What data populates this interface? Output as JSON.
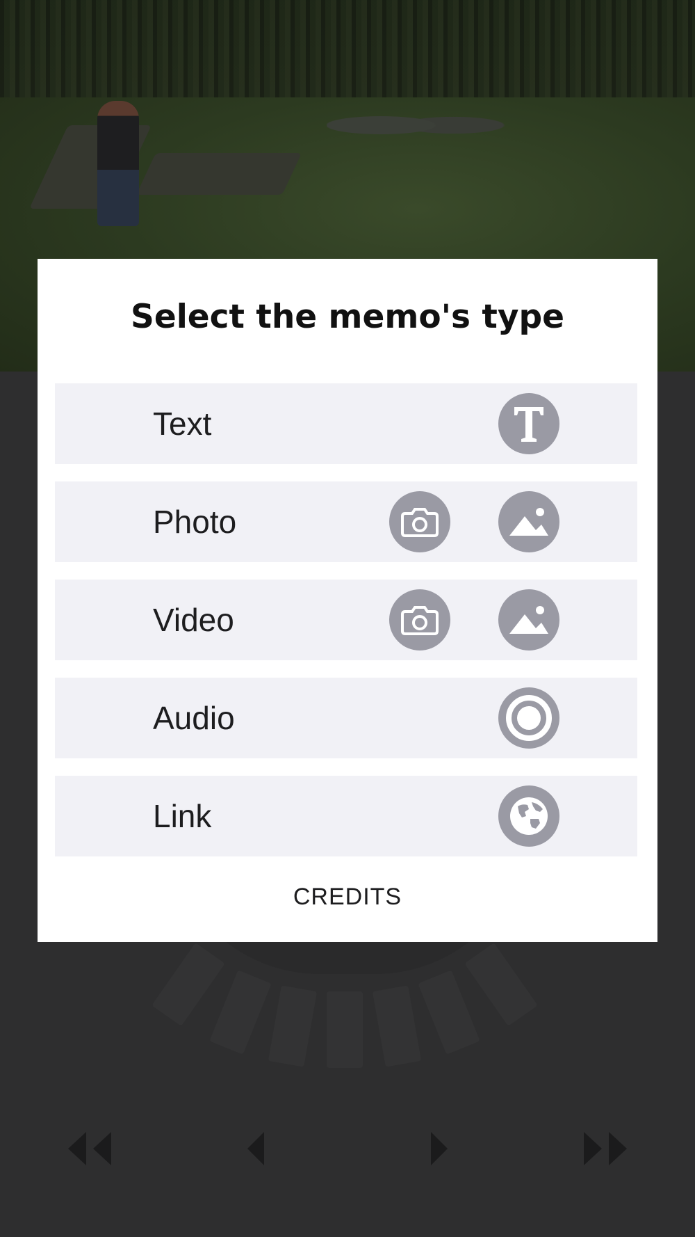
{
  "dialog": {
    "title": "Select the memo's type",
    "options": [
      {
        "label": "Text",
        "icons": [
          "text-icon"
        ]
      },
      {
        "label": "Photo",
        "icons": [
          "camera-icon",
          "gallery-icon"
        ]
      },
      {
        "label": "Video",
        "icons": [
          "camera-icon",
          "gallery-icon"
        ]
      },
      {
        "label": "Audio",
        "icons": [
          "record-icon"
        ]
      },
      {
        "label": "Link",
        "icons": [
          "globe-icon"
        ]
      }
    ],
    "credits_label": "CREDITS"
  },
  "navigation": {
    "icons": [
      "rewind-icon",
      "previous-icon",
      "next-icon",
      "fast-forward-icon"
    ]
  },
  "colors": {
    "overlay_bg": "#2e2e2f",
    "dialog_bg": "#ffffff",
    "row_bg": "#f1f1f6",
    "icon_circle": "#9a9aa4"
  }
}
